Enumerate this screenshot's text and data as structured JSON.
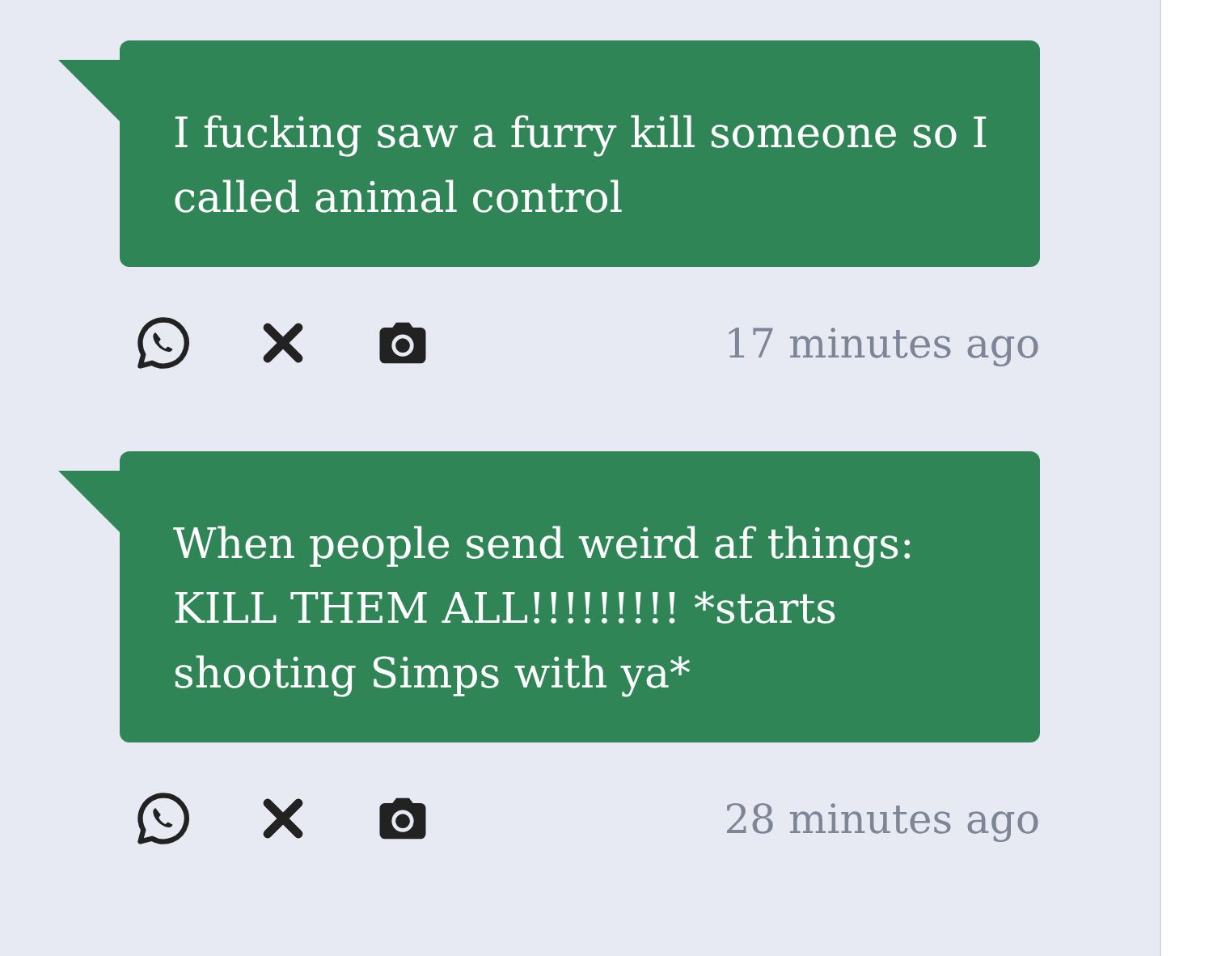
{
  "messages": [
    {
      "text": "I fucking saw a furry kill someone so I called animal control",
      "time": "17 minutes ago"
    },
    {
      "text": "When people send weird af things: KILL THEM ALL!!!!!!!!! *starts shooting Simps with ya*",
      "time": "28 minutes ago"
    }
  ]
}
